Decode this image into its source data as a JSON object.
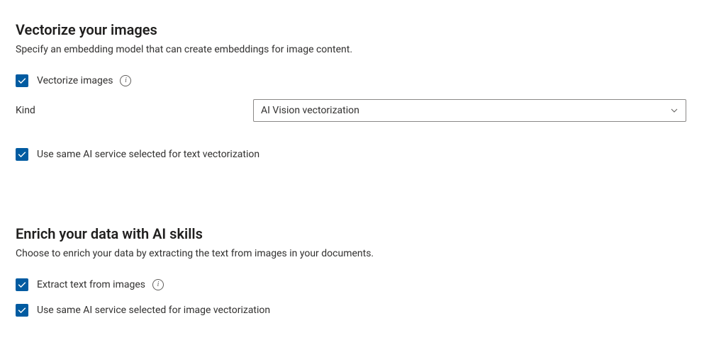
{
  "vectorize": {
    "title": "Vectorize your images",
    "subtitle": "Specify an embedding model that can create embeddings for image content.",
    "checkbox_label": "Vectorize images",
    "kind_label": "Kind",
    "kind_value": "AI Vision vectorization",
    "reuse_label": "Use same AI service selected for text vectorization"
  },
  "enrich": {
    "title": "Enrich your data with AI skills",
    "subtitle": "Choose to enrich your data by extracting the text from images in your documents.",
    "extract_label": "Extract text from images",
    "reuse_label": "Use same AI service selected for image vectorization"
  }
}
